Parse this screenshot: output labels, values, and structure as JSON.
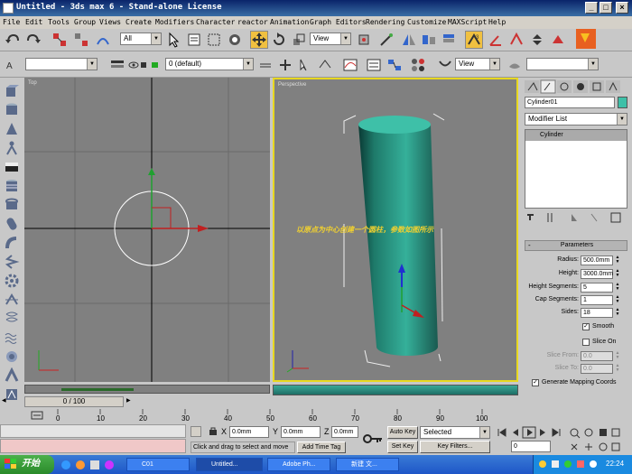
{
  "window": {
    "title": "Untitled - 3ds max 6 - Stand-alone License"
  },
  "menu": [
    "File",
    "Edit",
    "Tools",
    "Group",
    "Views",
    "Create",
    "Modifiers",
    "Character",
    "reactor",
    "Animation",
    "Graph Editors",
    "Rendering",
    "Customize",
    "MAXScript",
    "Help"
  ],
  "toolbar": {
    "selection_filter": "All",
    "ref_coord": "View",
    "layer": "0 (default)",
    "view_dropdown": "View"
  },
  "viewports": {
    "top_label": "Top",
    "perspective_label": "Perspective",
    "annotation": "以原点为中心创建一个圆柱，参数如图所示"
  },
  "command_panel": {
    "object_name": "Cylinder01",
    "modifier_list": "Modifier List",
    "stack_item": "Cylinder",
    "rollout_title": "Parameters",
    "params": [
      {
        "label": "Radius:",
        "value": "500.0mm"
      },
      {
        "label": "Height:",
        "value": "3000.0mm"
      },
      {
        "label": "Height Segments:",
        "value": "5"
      },
      {
        "label": "Cap Segments:",
        "value": "1"
      },
      {
        "label": "Sides:",
        "value": "18"
      }
    ],
    "smooth_label": "Smooth",
    "slice_on_label": "Slice On",
    "slice_from_label": "Slice From:",
    "slice_from_value": "0.0",
    "slice_to_label": "Slice To:",
    "slice_to_value": "0.0",
    "gen_mapping_label": "Generate Mapping Coords"
  },
  "timeline": {
    "frame_counter": "0 / 100",
    "ticks": [
      "0",
      "10",
      "20",
      "30",
      "40",
      "50",
      "60",
      "70",
      "80",
      "90",
      "100"
    ]
  },
  "status": {
    "x_label": "X",
    "x_value": "0.0mm",
    "y_label": "Y",
    "y_value": "0.0mm",
    "z_label": "Z",
    "z_value": "0.0mm",
    "prompt": "Click and drag to select and move",
    "add_time_tag": "Add Time Tag",
    "auto_key": "Auto Key",
    "set_key": "Set Key",
    "selected": "Selected",
    "key_filters": "Key Filters...",
    "frame": "0"
  },
  "taskbar": {
    "start": "开始",
    "tasks": [
      "C01",
      "Untitled...",
      "Adobe Ph...",
      "新建 文..."
    ],
    "clock": "22:24"
  },
  "colors": {
    "title_bar": "#0a246a",
    "viewport_bg": "#808080",
    "active_border": "#e8d820",
    "cylinder": "#2aa890",
    "annotation": "#f0d030",
    "highlight_box": "#cc2222",
    "taskbar": "#1e56c8"
  }
}
